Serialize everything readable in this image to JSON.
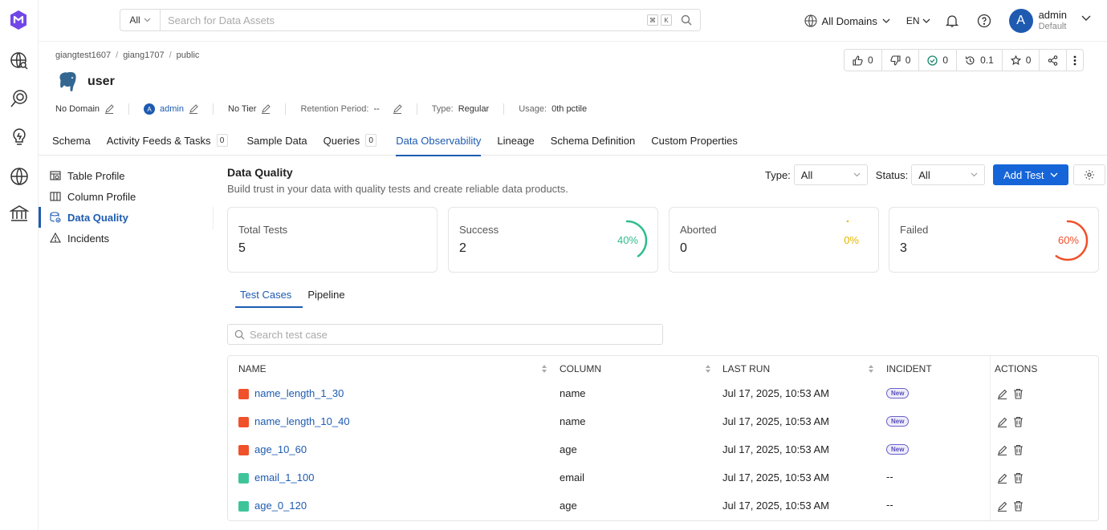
{
  "topbar": {
    "search_scope": "All",
    "search_placeholder": "Search for Data Assets",
    "kbd_cmd": "⌘",
    "kbd_k": "K",
    "domains": "All Domains",
    "language": "EN",
    "user_initial": "A",
    "user_name": "admin",
    "user_role": "Default"
  },
  "breadcrumb": [
    "giangtest1607",
    "giang1707",
    "public"
  ],
  "entity": {
    "name": "user",
    "domain": "No Domain",
    "owner_initial": "A",
    "owner": "admin",
    "tier": "No Tier",
    "retention_label": "Retention Period:",
    "retention_value": "--",
    "type_label": "Type:",
    "type_value": "Regular",
    "usage_label": "Usage:",
    "usage_value": "0th pctile"
  },
  "header_actions": {
    "upvotes": "0",
    "downvotes": "0",
    "tasks": "0",
    "version": "0.1",
    "followers": "0"
  },
  "tabs": [
    {
      "label": "Schema",
      "count": null
    },
    {
      "label": "Activity Feeds & Tasks",
      "count": "0"
    },
    {
      "label": "Sample Data",
      "count": null
    },
    {
      "label": "Queries",
      "count": "0"
    },
    {
      "label": "Data Observability",
      "count": null
    },
    {
      "label": "Lineage",
      "count": null
    },
    {
      "label": "Schema Definition",
      "count": null
    },
    {
      "label": "Custom Properties",
      "count": null
    }
  ],
  "left_menu": [
    "Table Profile",
    "Column Profile",
    "Data Quality",
    "Incidents"
  ],
  "data_quality": {
    "title": "Data Quality",
    "subtitle": "Build trust in your data with quality tests and create reliable data products.",
    "type_label": "Type:",
    "type_value": "All",
    "status_label": "Status:",
    "status_value": "All",
    "add_test": "Add Test"
  },
  "stats": [
    {
      "label": "Total Tests",
      "value": "5",
      "pct": null,
      "color": null
    },
    {
      "label": "Success",
      "value": "2",
      "pct": "40%",
      "fraction": 0.4,
      "color": "#2ebd8a"
    },
    {
      "label": "Aborted",
      "value": "0",
      "pct": "0%",
      "fraction": 0,
      "color": "#e8b500"
    },
    {
      "label": "Failed",
      "value": "3",
      "pct": "60%",
      "fraction": 0.6,
      "color": "#f0502a"
    }
  ],
  "subtabs": [
    "Test Cases",
    "Pipeline"
  ],
  "test_search_placeholder": "Search test case",
  "table": {
    "headers": [
      "NAME",
      "COLUMN",
      "LAST RUN",
      "INCIDENT",
      "ACTIONS"
    ],
    "rows": [
      {
        "name": "name_length_1_30",
        "column": "name",
        "last_run": "Jul 17, 2025, 10:53 AM",
        "incident": "New",
        "status_color": "#f0502a"
      },
      {
        "name": "name_length_10_40",
        "column": "name",
        "last_run": "Jul 17, 2025, 10:53 AM",
        "incident": "New",
        "status_color": "#f0502a"
      },
      {
        "name": "age_10_60",
        "column": "age",
        "last_run": "Jul 17, 2025, 10:53 AM",
        "incident": "New",
        "status_color": "#f0502a"
      },
      {
        "name": "email_1_100",
        "column": "email",
        "last_run": "Jul 17, 2025, 10:53 AM",
        "incident": "--",
        "status_color": "#3fc49a"
      },
      {
        "name": "age_0_120",
        "column": "age",
        "last_run": "Jul 17, 2025, 10:53 AM",
        "incident": "--",
        "status_color": "#3fc49a"
      }
    ]
  }
}
